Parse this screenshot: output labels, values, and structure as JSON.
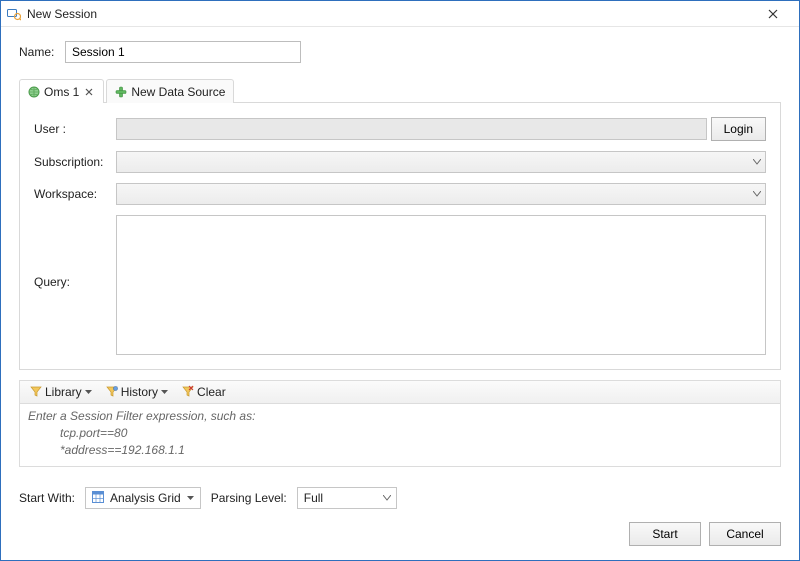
{
  "window": {
    "title": "New Session"
  },
  "name": {
    "label": "Name:",
    "value": "Session 1"
  },
  "tabs": {
    "active": {
      "label": "Oms 1"
    },
    "newDataSource": {
      "label": "New Data Source"
    }
  },
  "form": {
    "user": {
      "label": "User :",
      "value": "",
      "loginLabel": "Login"
    },
    "subscription": {
      "label": "Subscription:",
      "value": ""
    },
    "workspace": {
      "label": "Workspace:",
      "value": ""
    },
    "query": {
      "label": "Query:",
      "value": ""
    }
  },
  "filterBar": {
    "library": "Library",
    "history": "History",
    "clear": "Clear"
  },
  "filterPlaceholder": {
    "line1": "Enter a Session Filter expression, such as:",
    "line2": "tcp.port==80",
    "line3": "*address==192.168.1.1"
  },
  "startWith": {
    "label": "Start With:",
    "value": "Analysis Grid"
  },
  "parsingLevel": {
    "label": "Parsing Level:",
    "value": "Full"
  },
  "buttons": {
    "start": "Start",
    "cancel": "Cancel"
  }
}
